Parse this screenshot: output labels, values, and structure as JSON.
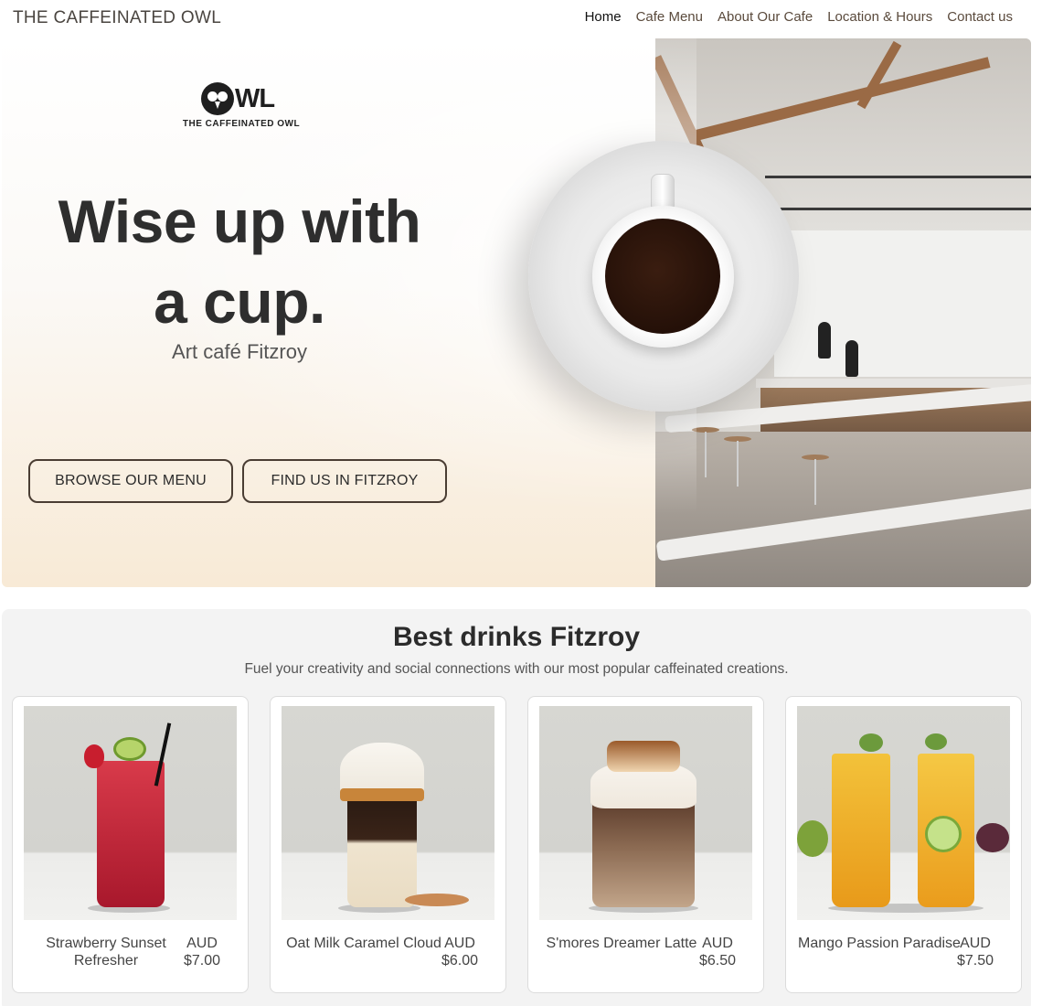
{
  "header": {
    "brand": "THE CAFFEINATED OWL",
    "nav": [
      "Home",
      "Cafe Menu",
      "About Our Cafe",
      "Location & Hours",
      "Contact us"
    ]
  },
  "hero": {
    "logo_mark": "WL",
    "logo_sub": "THE CAFFEINATED OWL",
    "headline": "Wise up with a cup.",
    "subline": "Art café Fitzroy",
    "buttons": [
      "BROWSE OUR MENU",
      "FIND US IN FITZROY"
    ]
  },
  "drinks": {
    "title": "Best drinks Fitzroy",
    "subtitle": "Fuel your creativity and social connections with our most popular caffeinated creations.",
    "items": [
      {
        "name": "Strawberry Sunset Refresher",
        "currency": "AUD",
        "price": "$7.00"
      },
      {
        "name": "Oat Milk Caramel Cloud",
        "currency": "AUD",
        "price": "$6.00"
      },
      {
        "name": "S'mores Dreamer Latte",
        "currency": "AUD",
        "price": "$6.50"
      },
      {
        "name": "Mango Passion Paradise",
        "currency": "AUD",
        "price": "$7.50"
      }
    ]
  },
  "colors": {
    "button_border": "#4a3d33",
    "hero_gradient_bottom": "#f8ead6",
    "section_bg": "#f3f3f3"
  },
  "icons": [
    "owl-logo-icon"
  ]
}
